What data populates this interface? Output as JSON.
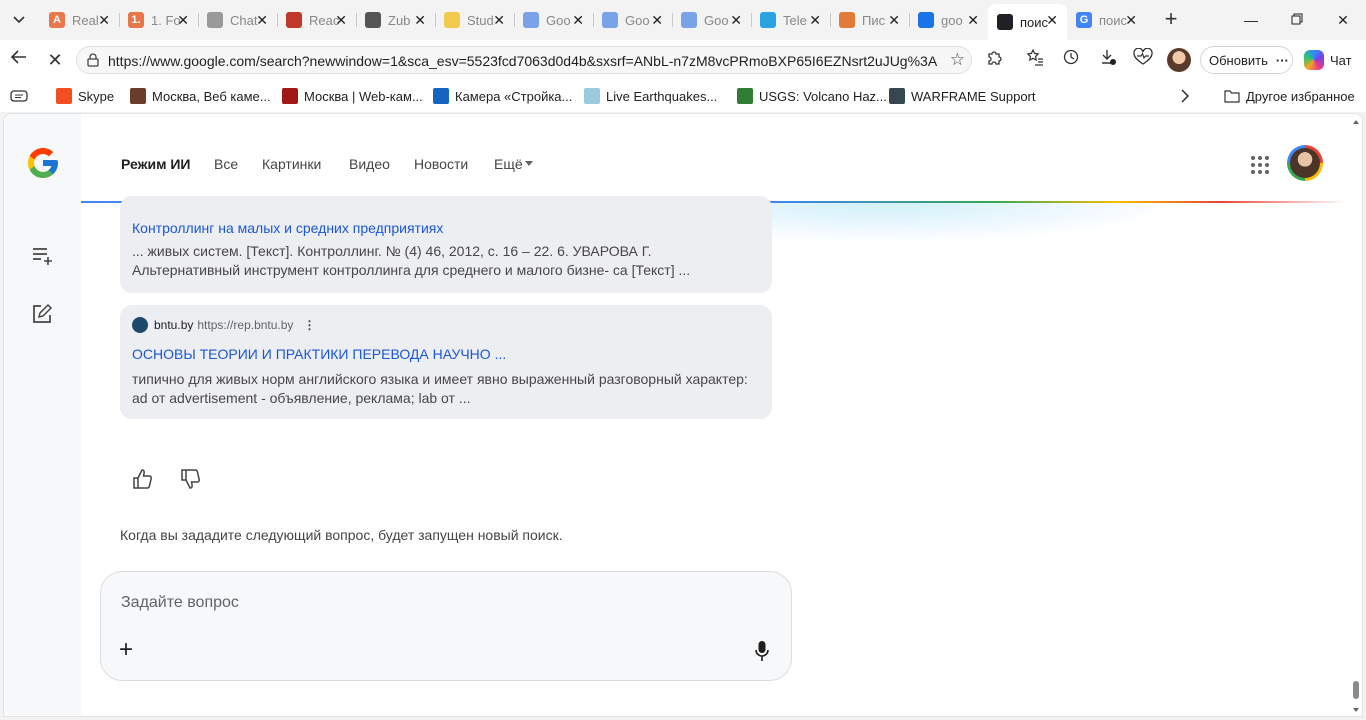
{
  "browser": {
    "tabs": [
      {
        "icon": "A",
        "title": "Real",
        "color": "#e8774a",
        "active": false
      },
      {
        "icon": "1.",
        "title": "1. Fo",
        "color": "#e8774a",
        "active": false
      },
      {
        "icon": "",
        "title": "Chat",
        "color": "#9a9a9a",
        "active": false
      },
      {
        "icon": "",
        "title": "Reac",
        "color": "#c0392b",
        "active": false
      },
      {
        "icon": "",
        "title": "Zub",
        "color": "#555555",
        "active": false
      },
      {
        "icon": "",
        "title": "Stud",
        "color": "#f2c94c",
        "active": false
      },
      {
        "icon": "",
        "title": "Goo",
        "color": "#7aa2e8",
        "active": false
      },
      {
        "icon": "",
        "title": "Goo",
        "color": "#7aa2e8",
        "active": false
      },
      {
        "icon": "",
        "title": "Goo",
        "color": "#7aa2e8",
        "active": false
      },
      {
        "icon": "",
        "title": "Tele",
        "color": "#2aa3e0",
        "active": false
      },
      {
        "icon": "",
        "title": "Пис",
        "color": "#e07b39",
        "active": false
      },
      {
        "icon": "",
        "title": "goo",
        "color": "#1a73e8",
        "active": false
      },
      {
        "icon": "",
        "title": "поис",
        "color": "#202124",
        "active": true
      },
      {
        "icon": "G",
        "title": "поис",
        "color": "#4285f4",
        "active": false
      }
    ],
    "address": {
      "url": "https://www.google.com/search?newwindow=1&sca_esv=5523fcd7063d0d4b&sxsrf=ANbL-n7zM8vcPRmoBXP65I6EZNsrt2uJUg%3A..."
    },
    "update_label": "Обновить",
    "chat_label": "Чат",
    "bookmarks": [
      {
        "label": "Skype",
        "color": "#f25022"
      },
      {
        "label": "Москва, Веб каме...",
        "color": "#6a3d2a"
      },
      {
        "label": "Москва | Web-кам...",
        "color": "#a01818"
      },
      {
        "label": "Камера «Стройка...",
        "color": "#1565c0"
      },
      {
        "label": "Live Earthquakes...",
        "color": "#9ecae1"
      },
      {
        "label": "USGS: Volcano Haz...",
        "color": "#2e7d32"
      },
      {
        "label": "WARFRAME Support",
        "color": "#37474f"
      }
    ],
    "other_bookmarks": "Другое избранное"
  },
  "google": {
    "tabs": [
      "Режим ИИ",
      "Все",
      "Картинки",
      "Видео",
      "Новости",
      "Ещё"
    ]
  },
  "results": [
    {
      "title": "Контроллинг на малых и средних предприятиях",
      "snippet": "... живых систем. [Текст]. Контроллинг. № (4) 46, 2012, с. 16 – 22. 6. УВАРОВА Г. Альтернативный инструмент контроллинга для среднего и малого бизне- са [Текст] ..."
    },
    {
      "source": "bntu.by",
      "url": "https://rep.bntu.by",
      "title": "ОСНОВЫ ТЕОРИИ И ПРАКТИКИ ПЕРЕВОДА НАУЧНО ...",
      "snippet": "типично для живых норм английского языка и имеет явно выраженный разговорный характер: ad от advertisement - объявление, реклама; lab от ..."
    }
  ],
  "followup_notice": "Когда вы зададите следующий вопрос, будет запущен новый поиск.",
  "ask": {
    "placeholder": "Задайте вопрос"
  }
}
